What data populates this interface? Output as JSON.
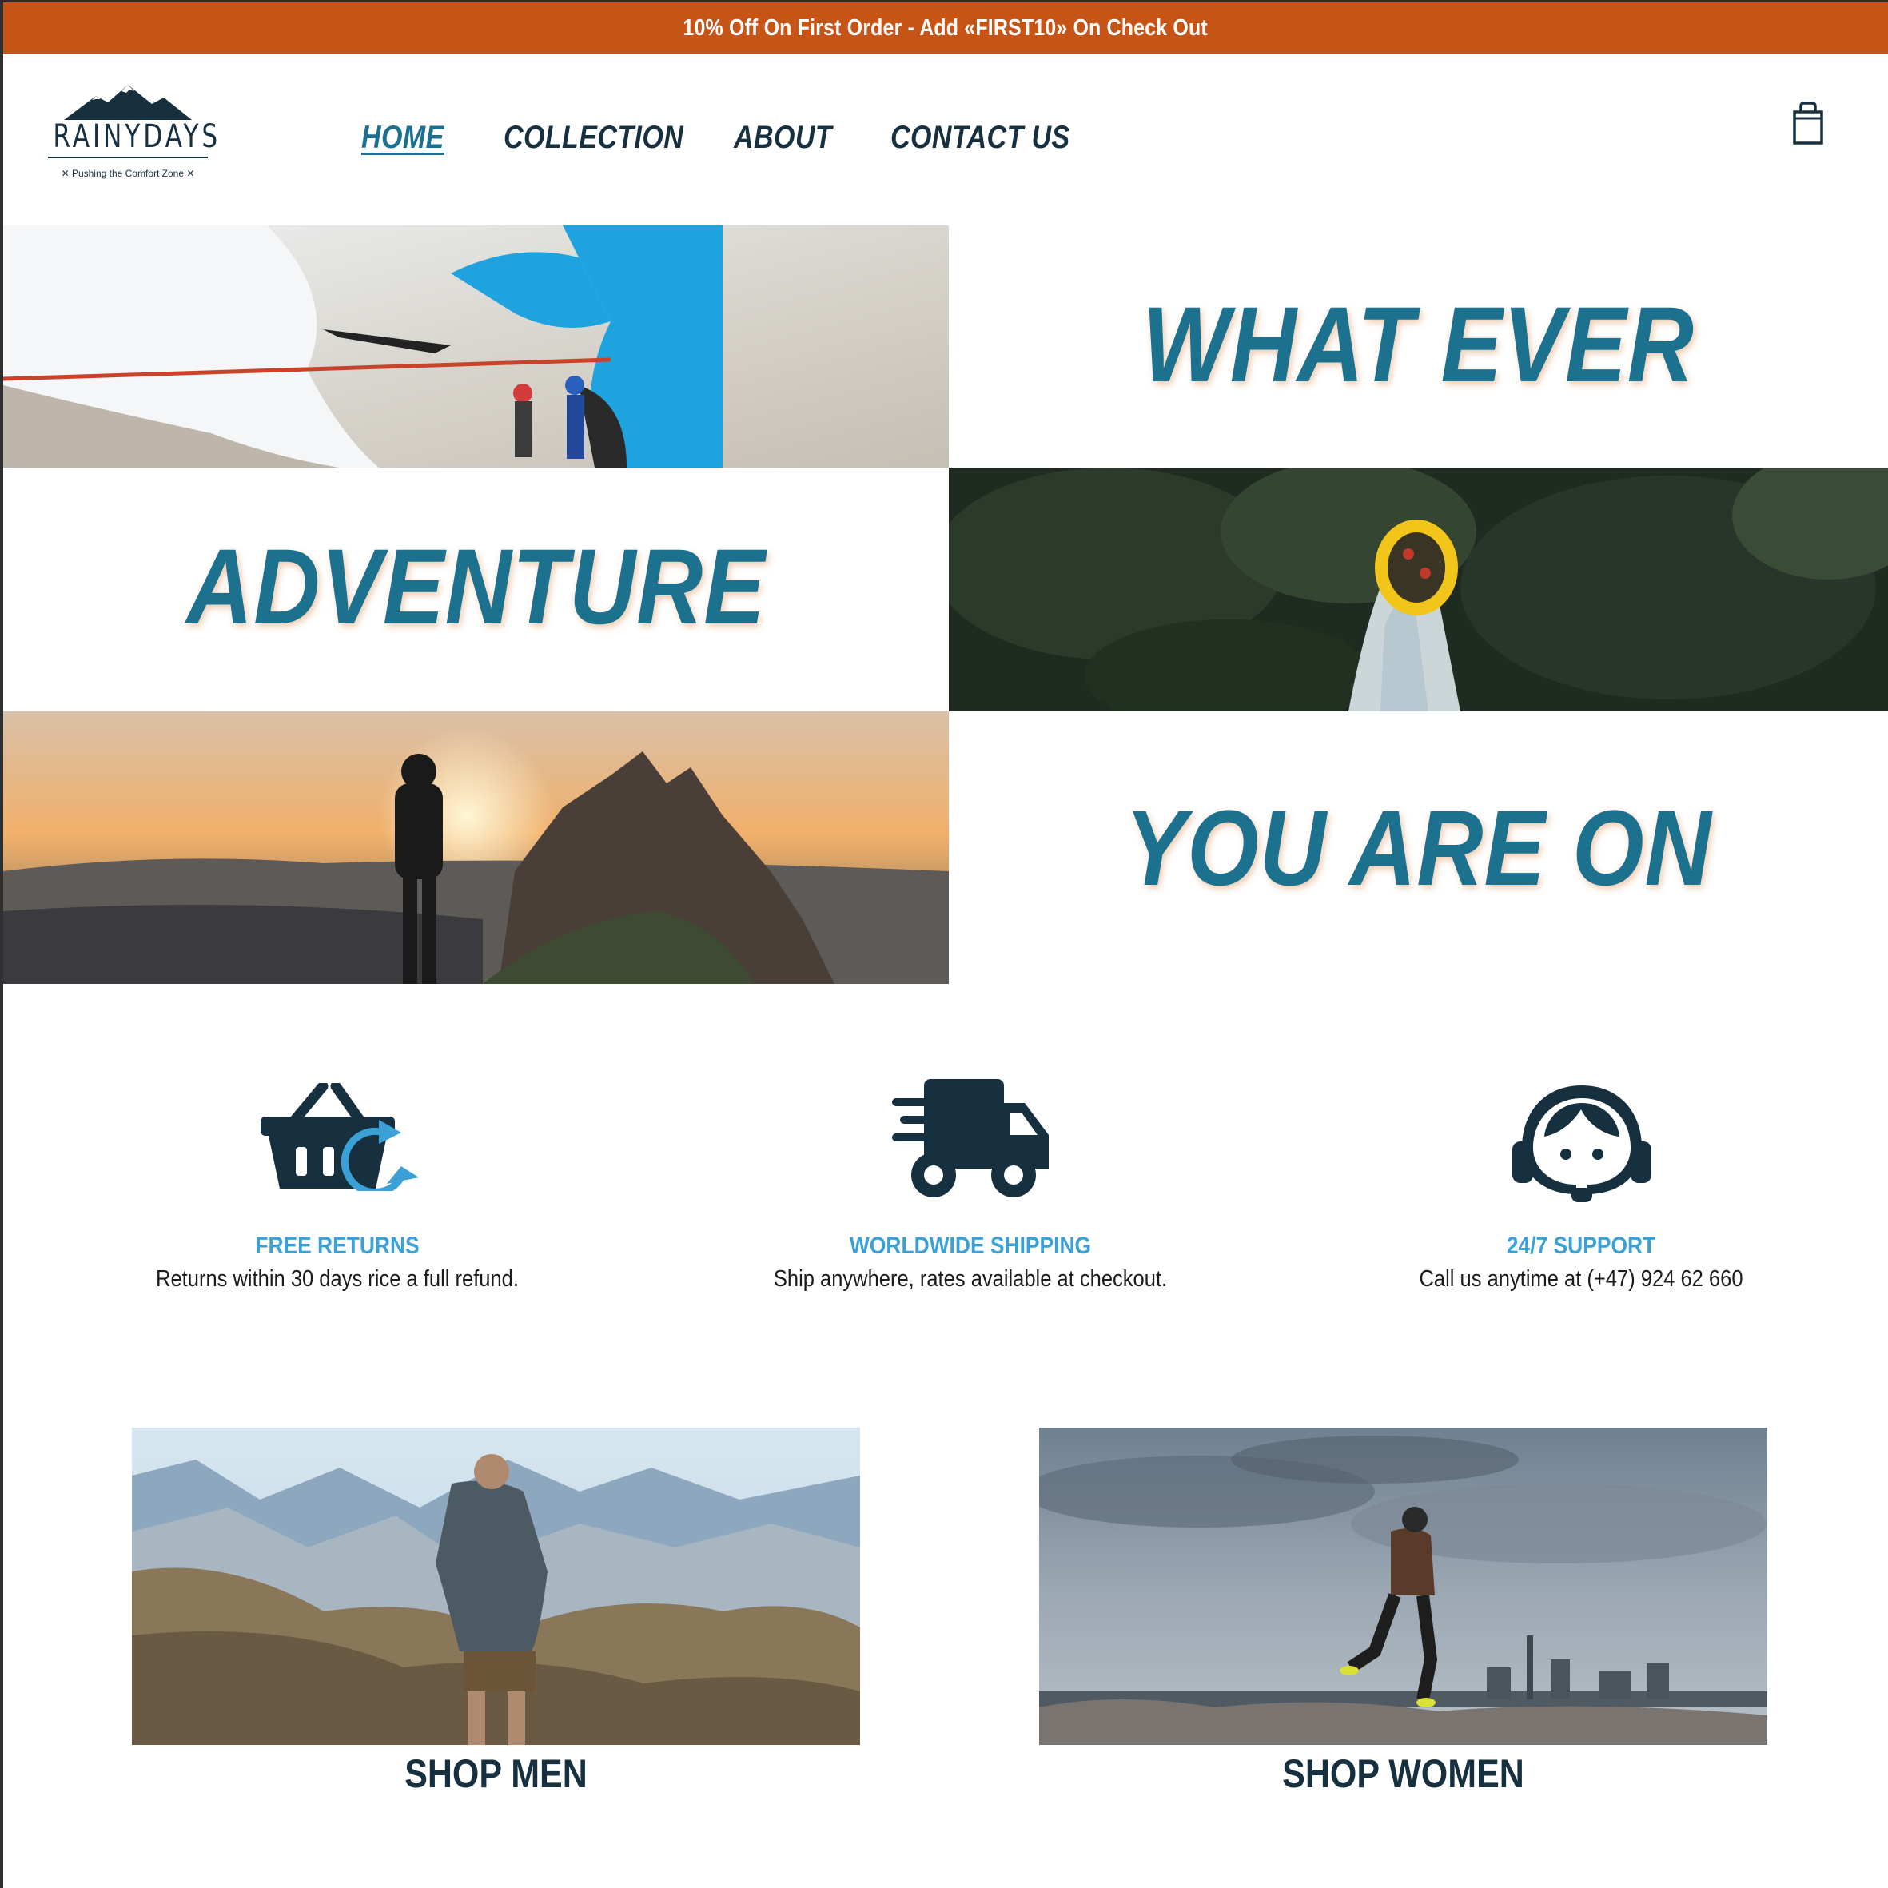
{
  "promo": {
    "text": "10% Off On First Order - Add «FIRST10» On Check Out"
  },
  "logo": {
    "name": "RAINYDAYS",
    "tagline": "✕ Pushing the Comfort Zone ✕"
  },
  "nav": {
    "items": [
      {
        "label": "HOME",
        "active": true
      },
      {
        "label": "COLLECTION",
        "active": false
      },
      {
        "label": "ABOUT",
        "active": false
      },
      {
        "label": "CONTACT US",
        "active": false
      }
    ]
  },
  "cart": {
    "icon": "shopping-bag-icon"
  },
  "hero": {
    "line1": "WHAT EVER",
    "line2": "ADVENTURE",
    "line3": "YOU ARE ON",
    "images": [
      "ice-climbing-photo",
      "river-rafting-photo",
      "mountain-sunrise-photo"
    ]
  },
  "features": [
    {
      "icon": "basket-return-icon",
      "title": "FREE RETURNS",
      "text": "Returns within 30 days rice a full refund."
    },
    {
      "icon": "delivery-truck-icon",
      "title": "WORLDWIDE SHIPPING",
      "text": "Ship anywhere, rates available at checkout."
    },
    {
      "icon": "headset-support-icon",
      "title": "24/7 SUPPORT",
      "text": "Call us anytime at (+47) 924 62 660"
    }
  ],
  "shop": {
    "men_label": "SHOP MEN",
    "women_label": "SHOP WOMEN"
  },
  "colors": {
    "banner": "#c65417",
    "accent": "#1c718e",
    "navy": "#17303f",
    "feature_title": "#3aa0d5"
  }
}
